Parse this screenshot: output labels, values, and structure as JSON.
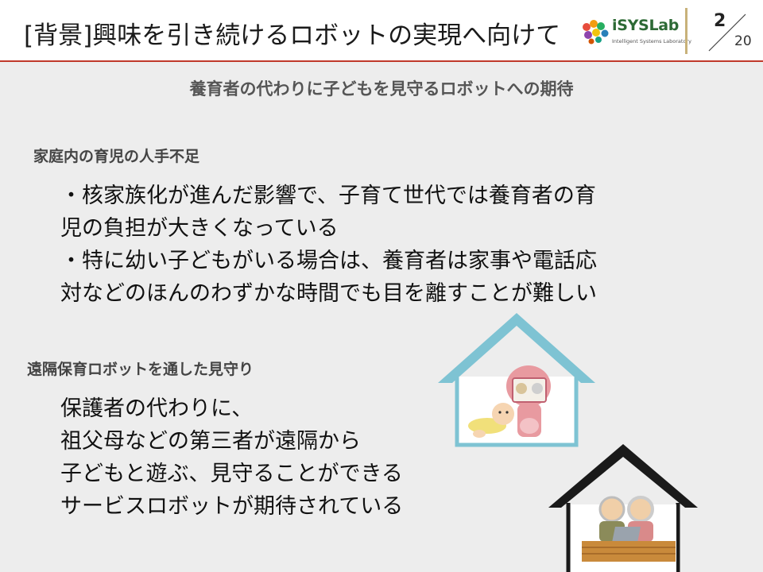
{
  "header": {
    "title": "[背景]興味を引き続けるロボットの実現へ向けて",
    "logo_text": "iSYSLab",
    "logo_sub": "Intelligent Systems Laboratory",
    "page_number": "2",
    "page_total": "20"
  },
  "subtitle": "養育者の代わりに子どもを見守るロボットへの期待",
  "section1": {
    "heading": "家庭内の育児の人手不足",
    "lines": [
      "・核家族化が進んだ影響で、子育て世代では養育者の育",
      "児の負担が大きくなっている",
      "・特に幼い子どもがいる場合は、養育者は家事や電話応",
      "対などのほんのわずかな時間でも目を離すことが難しい"
    ]
  },
  "section2": {
    "heading": "遠隔保育ロボットを通した見守り",
    "lines": [
      "保護者の代わりに、",
      "祖父母などの第三者が遠隔から",
      "子どもと遊ぶ、見守ることができる",
      "サービスロボットが期待されている"
    ]
  },
  "icons": [
    "logo-icon",
    "house-with-robot-and-baby-illustration",
    "house-with-grandparents-illustration"
  ],
  "colors": {
    "accent_line": "#c0392b",
    "house_teal": "#7ec3d3",
    "house_dark": "#1a1a1a",
    "divider": "#c8b27a"
  }
}
